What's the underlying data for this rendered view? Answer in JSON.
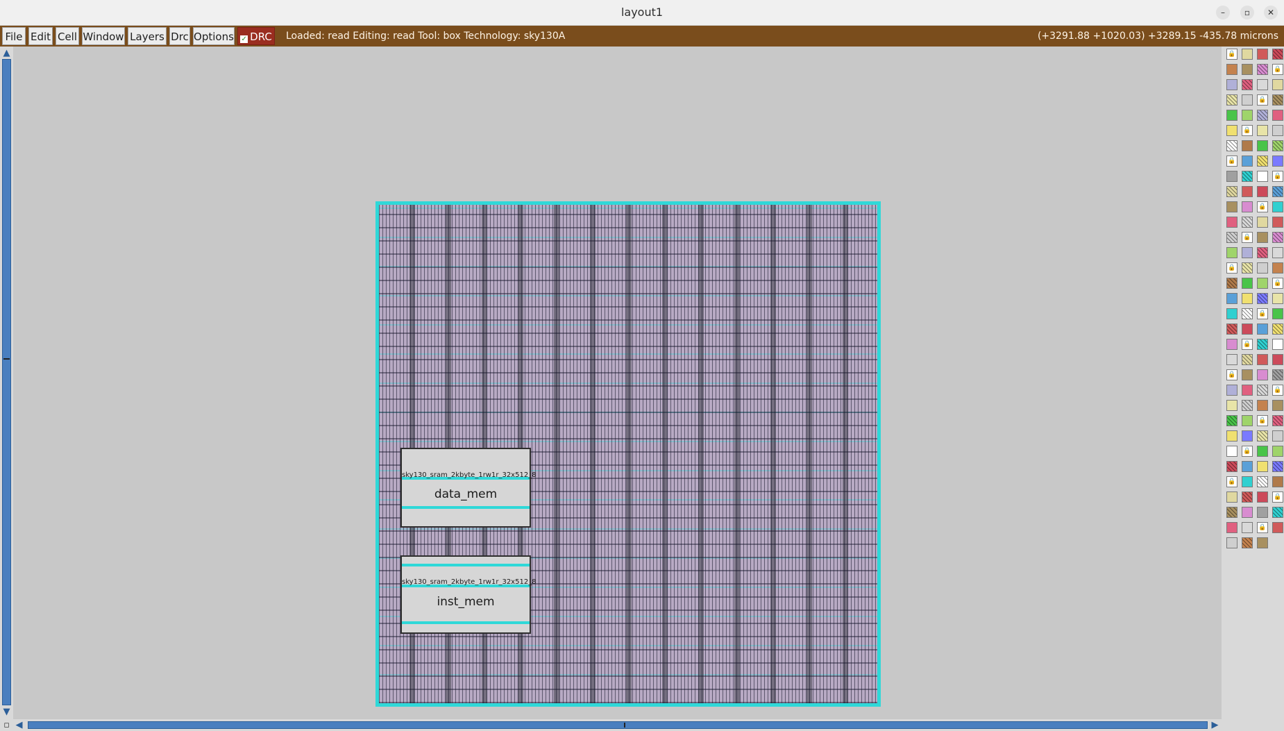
{
  "window": {
    "title": "layout1"
  },
  "menu": {
    "items": [
      "File",
      "Edit",
      "Cell",
      "Window",
      "Layers",
      "Drc",
      "Options"
    ],
    "drc_toggle": "DRC",
    "status": "Loaded: read Editing: read Tool: box  Technology: sky130A",
    "coordinates": "(+3291.88 +1020.03) +3289.15 -435.78 microns"
  },
  "layout": {
    "macros": [
      {
        "cell": "sky130_sram_2kbyte_1rw1r_32x512_8",
        "instance": "data_mem"
      },
      {
        "cell": "sky130_sram_2kbyte_1rw1r_32x512_8",
        "instance": "inst_mem"
      }
    ]
  },
  "colors": {
    "menubar": "#7a4d1c",
    "drc_button": "#9a2d20",
    "canvas": "#c8c8c8",
    "chip_outline": "#2fd8d8",
    "scrollbar": "#4a7fbf"
  },
  "icons": {
    "close": "close-icon",
    "maximize": "maximize-icon",
    "minimize": "minimize-icon",
    "scroll_up": "arrow-up-icon",
    "scroll_down": "arrow-down-icon",
    "scroll_left": "arrow-left-icon",
    "scroll_right": "arrow-right-icon",
    "lock": "lock-icon"
  }
}
